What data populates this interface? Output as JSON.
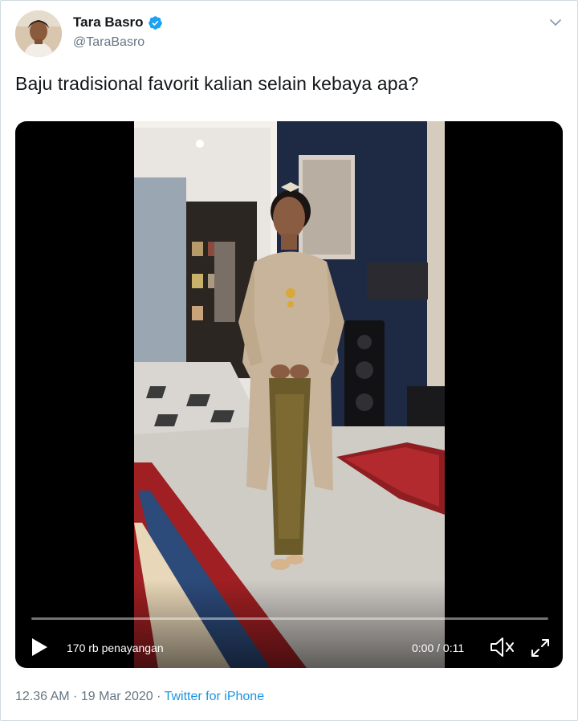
{
  "author": {
    "name": "Tara Basro",
    "handle": "@TaraBasro",
    "verified_icon": "verified-badge-icon",
    "avatar_icon": "avatar"
  },
  "tweet": {
    "text": "Baju tradisional favorit kalian selain kebaya apa?"
  },
  "video": {
    "views": "170 rb penayangan",
    "time": "0:00 / 0:11",
    "progress": 0,
    "icons": [
      "play-icon",
      "volume-icon",
      "fullscreen-icon"
    ]
  },
  "meta": {
    "timestamp": "12.36 AM · 19 Mar 2020 · ",
    "source": "Twitter for iPhone"
  },
  "colors": {
    "link": "#1b95e0",
    "muted": "#657786",
    "verified": "#1da1f2",
    "text": "#14171a"
  }
}
